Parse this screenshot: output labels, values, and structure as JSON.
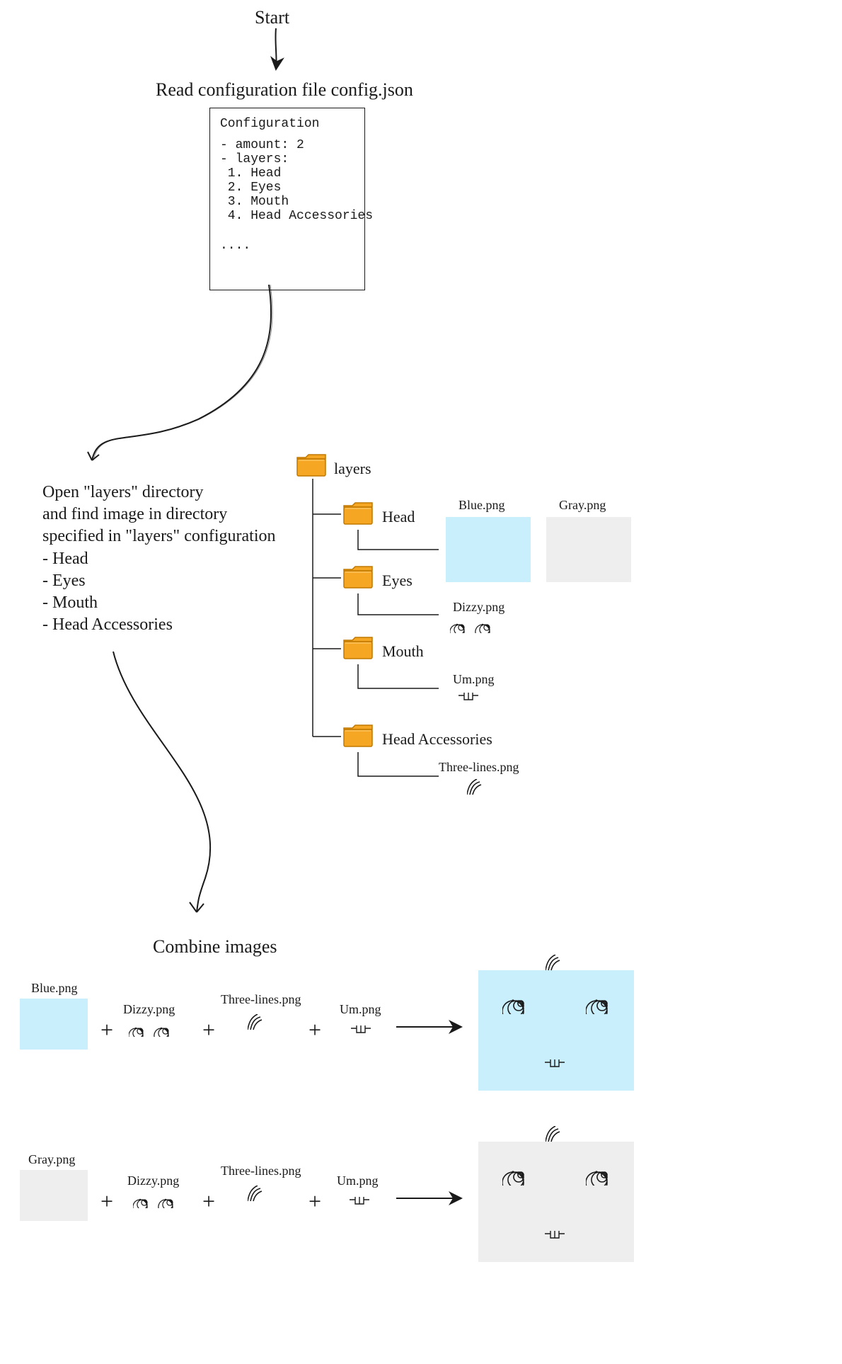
{
  "start_label": "Start",
  "step1_label": "Read configuration file config.json",
  "config_box": {
    "title": "Configuration",
    "line_amount": "- amount: 2",
    "line_layers": "- layers:",
    "layers": [
      " 1. Head",
      " 2. Eyes",
      " 3. Mouth",
      " 4. Head Accessories"
    ],
    "ellipsis": "...."
  },
  "step2_text": "Open \"layers\" directory\nand find image in directory\nspecified in \"layers\" configuration\n- Head\n- Eyes\n- Mouth\n- Head Accessories",
  "tree": {
    "root": "layers",
    "folders": [
      "Head",
      "Eyes",
      "Mouth",
      "Head Accessories"
    ],
    "head_files": [
      "Blue.png",
      "Gray.png"
    ],
    "eyes_file": "Dizzy.png",
    "mouth_file": "Um.png",
    "accessory_file": "Three-lines.png"
  },
  "step3_label": "Combine images",
  "combine": {
    "plus": "+",
    "rows": [
      {
        "head": "Blue.png",
        "eyes": "Dizzy.png",
        "hair": "Three-lines.png",
        "mouth": "Um.png",
        "bg": "blue"
      },
      {
        "head": "Gray.png",
        "eyes": "Dizzy.png",
        "hair": "Three-lines.png",
        "mouth": "Um.png",
        "bg": "gray"
      }
    ]
  },
  "colors": {
    "folder_fill": "#f5a623",
    "folder_stroke": "#c07800",
    "blue": "#c9eefc",
    "gray": "#eeeeee"
  }
}
